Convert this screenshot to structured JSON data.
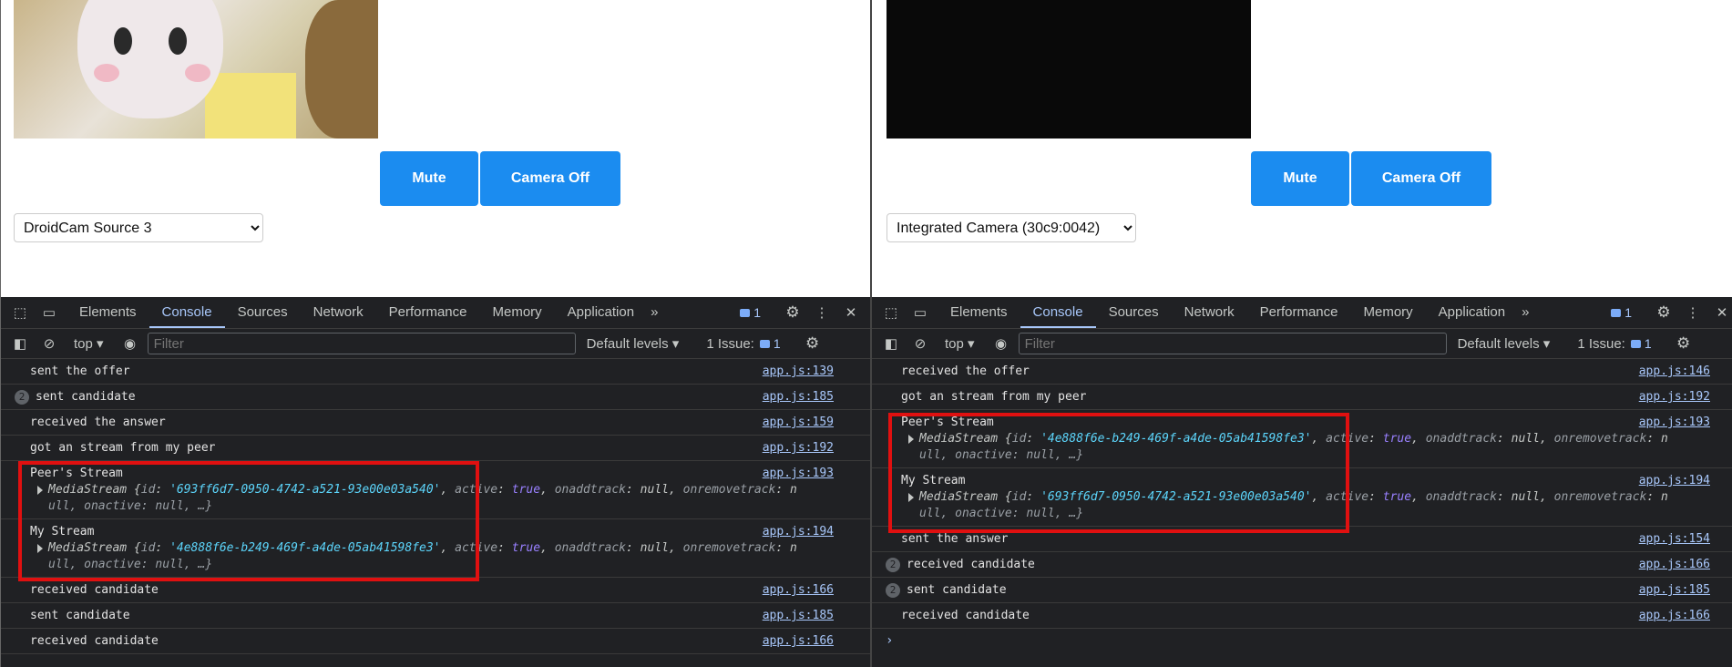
{
  "left": {
    "controls": {
      "mute_label": "Mute",
      "camera_label": "Camera Off",
      "device_selected": "DroidCam Source 3"
    },
    "devtools": {
      "tabs": [
        "Elements",
        "Console",
        "Sources",
        "Network",
        "Performance",
        "Memory",
        "Application"
      ],
      "active_tab": "Console",
      "issue_count": "1",
      "context": "top",
      "filter_placeholder": "Filter",
      "levels_label": "Default levels",
      "issues_label": "1 Issue:",
      "issues_count": "1"
    },
    "logs": [
      {
        "text": "sent the offer",
        "src": "app.js:139"
      },
      {
        "text": "sent candidate",
        "src": "app.js:185",
        "count": "2"
      },
      {
        "text": "received the answer",
        "src": "app.js:159"
      },
      {
        "text": "got an stream from my peer",
        "src": "app.js:192"
      },
      {
        "text": "Peer's Stream",
        "src": "app.js:193",
        "obj_id": "'693ff6d7-0950-4742-a521-93e00e03a540'",
        "obj_line1_rest": ", active: true, onaddtrack: null, onremovetrack: n",
        "obj_line2": "ull, onactive: null, …}"
      },
      {
        "text": "My Stream",
        "src": "app.js:194",
        "obj_id": "'4e888f6e-b249-469f-a4de-05ab41598fe3'",
        "obj_line1_rest": ", active: true, onaddtrack: null, onremovetrack: n",
        "obj_line2": "ull, onactive: null, …}"
      },
      {
        "text": "received candidate",
        "src": "app.js:166"
      },
      {
        "text": "sent candidate",
        "src": "app.js:185"
      },
      {
        "text": "received candidate",
        "src": "app.js:166"
      }
    ]
  },
  "right": {
    "controls": {
      "mute_label": "Mute",
      "camera_label": "Camera Off",
      "device_selected": "Integrated Camera (30c9:0042)"
    },
    "devtools": {
      "tabs": [
        "Elements",
        "Console",
        "Sources",
        "Network",
        "Performance",
        "Memory",
        "Application"
      ],
      "active_tab": "Console",
      "issue_count": "1",
      "context": "top",
      "filter_placeholder": "Filter",
      "levels_label": "Default levels",
      "issues_label": "1 Issue:",
      "issues_count": "1"
    },
    "logs": [
      {
        "text": "received the offer",
        "src": "app.js:146"
      },
      {
        "text": "got an stream from my peer",
        "src": "app.js:192"
      },
      {
        "text": "Peer's Stream",
        "src": "app.js:193",
        "obj_id": "'4e888f6e-b249-469f-a4de-05ab41598fe3'",
        "obj_line1_rest": ", active: true, onaddtrack: null, onremovetrack: n",
        "obj_line2": "ull, onactive: null, …}"
      },
      {
        "text": "My Stream",
        "src": "app.js:194",
        "obj_id": "'693ff6d7-0950-4742-a521-93e00e03a540'",
        "obj_line1_rest": ", active: true, onaddtrack: null, onremovetrack: n",
        "obj_line2": "ull, onactive: null, …}"
      },
      {
        "text": "sent the answer",
        "src": "app.js:154"
      },
      {
        "text": "received candidate",
        "src": "app.js:166",
        "count": "2"
      },
      {
        "text": "sent candidate",
        "src": "app.js:185",
        "count": "2"
      },
      {
        "text": "received candidate",
        "src": "app.js:166"
      }
    ],
    "prompt": "›"
  },
  "common": {
    "obj_type": "MediaStream",
    "obj_open": "{",
    "obj_id_key": "id",
    "more_tabs": "»"
  },
  "colors": {
    "accent_button": "#1b8cf0",
    "highlight_box": "#e01010",
    "devtools_bg": "#202124"
  }
}
